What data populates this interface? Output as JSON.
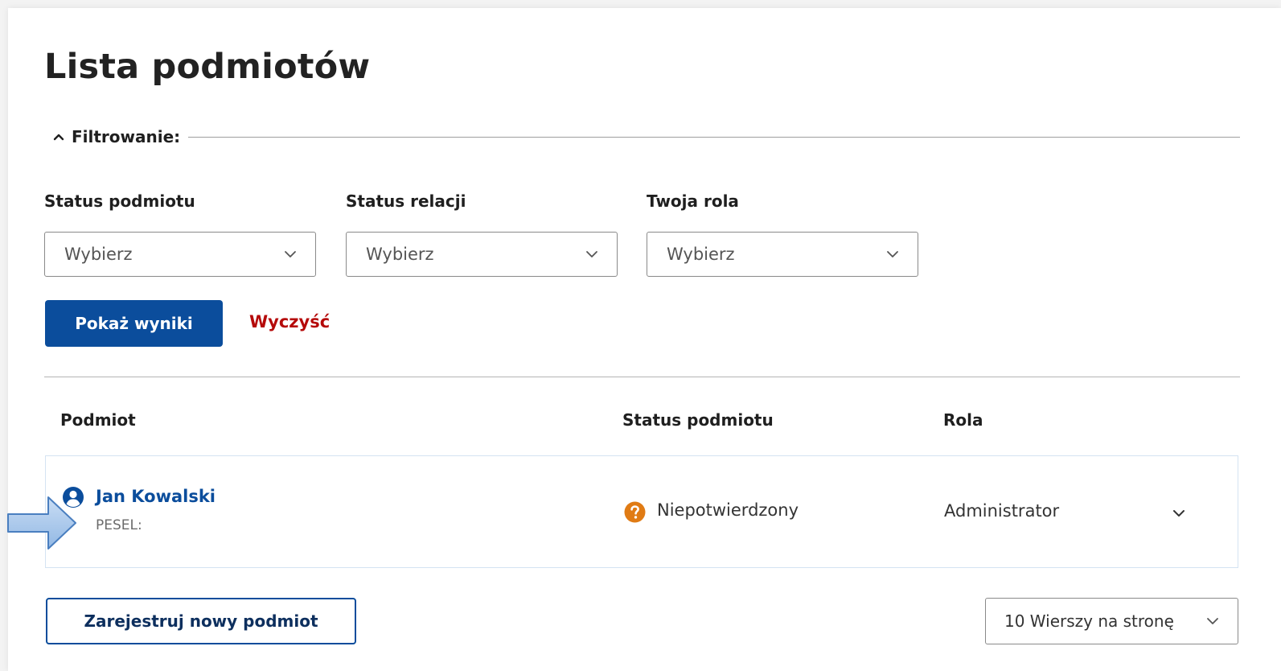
{
  "page": {
    "title": "Lista podmiotów"
  },
  "filter": {
    "label": "Filtrowanie:",
    "fields": [
      {
        "label": "Status podmiotu",
        "value": "Wybierz"
      },
      {
        "label": "Status relacji",
        "value": "Wybierz"
      },
      {
        "label": "Twoja rola",
        "value": "Wybierz"
      }
    ],
    "submit_label": "Pokaż wyniki",
    "clear_label": "Wyczyść"
  },
  "table": {
    "columns": [
      "Podmiot",
      "Status podmiotu",
      "Rola"
    ],
    "rows": [
      {
        "name": "Jan Kowalski",
        "pesel_label": "PESEL:",
        "status": "Niepotwierdzony",
        "role": "Administrator",
        "status_icon": "question-circle-icon"
      }
    ]
  },
  "footer": {
    "register_label": "Zarejestruj nowy podmiot",
    "per_page_label": "10 Wierszy na stronę"
  },
  "colors": {
    "primary": "#0b4d9c",
    "danger": "#b50a0a",
    "status_warning": "#e07b14",
    "arrow_fill": "#a8c8ec",
    "arrow_stroke": "#4a7fc0"
  }
}
